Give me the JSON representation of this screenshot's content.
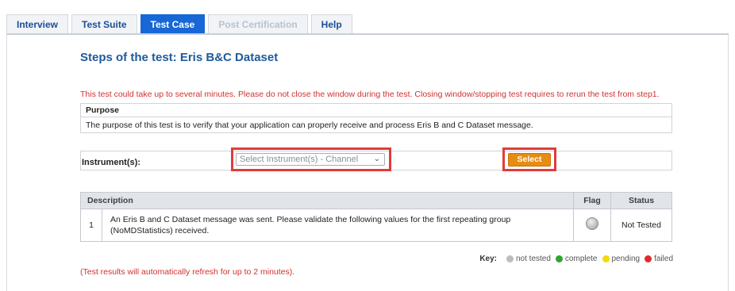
{
  "tabs": [
    {
      "label": "Interview",
      "state": "normal"
    },
    {
      "label": "Test Suite",
      "state": "normal"
    },
    {
      "label": "Test Case",
      "state": "active"
    },
    {
      "label": "Post Certification",
      "state": "disabled"
    },
    {
      "label": "Help",
      "state": "normal"
    }
  ],
  "page_title": "Steps of the test: Eris B&C Dataset",
  "warning": "This test could take up to several minutes. Please do not close the window during the test. Closing window/stopping test requires to rerun the test from step1.",
  "purpose": {
    "heading": "Purpose",
    "text": "The purpose of this test is to verify that your application can properly receive and process Eris B and C Dataset message."
  },
  "instrument": {
    "label": "Instrument(s):",
    "dropdown_value": "Select Instrument(s) - Channel",
    "select_button": "Select"
  },
  "steps_table": {
    "headers": {
      "description": "Description",
      "flag": "Flag",
      "status": "Status"
    },
    "rows": [
      {
        "number": "1",
        "description": "An Eris B and C Dataset message was sent. Please validate the following values for the first repeating group (NoMDStatistics) received.",
        "flag": "not-tested-icon",
        "status": "Not Tested"
      }
    ]
  },
  "key": {
    "label": "Key:",
    "items": [
      {
        "label": "not tested",
        "color": "#bdbdbd"
      },
      {
        "label": "complete",
        "color": "#2fa52f"
      },
      {
        "label": "pending",
        "color": "#f4d90b"
      },
      {
        "label": "failed",
        "color": "#e02a2a"
      }
    ]
  },
  "refresh_note": "(Test results will automatically refresh for up to 2 minutes)."
}
